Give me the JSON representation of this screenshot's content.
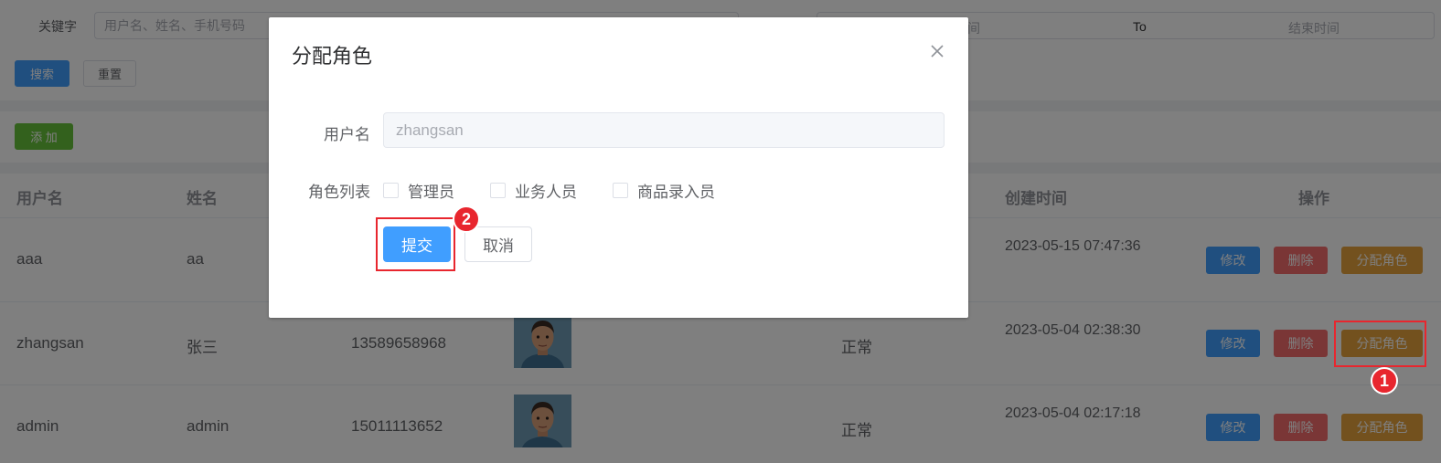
{
  "filter": {
    "keyword_label": "关键字",
    "keyword_placeholder": "用户名、姓名、手机号码",
    "date_start_placeholder": "时间",
    "date_separator": "To",
    "date_end_placeholder": "结束时间",
    "search_label": "搜索",
    "reset_label": "重置"
  },
  "toolbar": {
    "add_label": "添 加"
  },
  "table": {
    "headers": {
      "username": "用户名",
      "name": "姓名",
      "created": "创建时间",
      "actions": "操作"
    },
    "rows": [
      {
        "username": "aaa",
        "name": "aa",
        "phone": "",
        "status": "",
        "created": "2023-05-15 07:47:36"
      },
      {
        "username": "zhangsan",
        "name": "张三",
        "phone": "13589658968",
        "status": "正常",
        "created": "2023-05-04 02:38:30"
      },
      {
        "username": "admin",
        "name": "admin",
        "phone": "15011113652",
        "status": "正常",
        "created": "2023-05-04 02:17:18"
      }
    ],
    "actions": {
      "edit": "修改",
      "delete": "删除",
      "assign_role": "分配角色"
    }
  },
  "dialog": {
    "title": "分配角色",
    "username_label": "用户名",
    "username_value": "zhangsan",
    "roles_label": "角色列表",
    "roles": [
      {
        "label": "管理员",
        "checked": false
      },
      {
        "label": "业务人员",
        "checked": false
      },
      {
        "label": "商品录入员",
        "checked": false
      }
    ],
    "submit_label": "提交",
    "cancel_label": "取消"
  },
  "annotations": {
    "marker1": "1",
    "marker2": "2",
    "color": "#e8262e"
  },
  "colors": {
    "primary": "#409eff",
    "success": "#67c23a",
    "danger": "#f56c6c",
    "warning": "#e6a23c"
  }
}
